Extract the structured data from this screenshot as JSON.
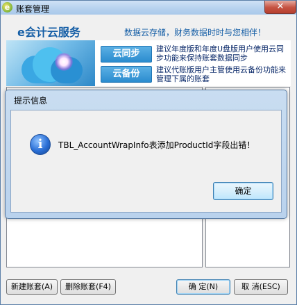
{
  "window": {
    "title": "账套管理",
    "app_icon": "e",
    "close_glyph": "✕"
  },
  "banner": {
    "title": "e会计云服务",
    "slogan": "数据云存储，财务数据时时与您相伴！",
    "services": [
      {
        "label": "云同步",
        "desc": "建议年度版和年度U盘版用户使用云同步功能来保持账套数据同步"
      },
      {
        "label": "云备份",
        "desc": "建议代账版用户主管使用云备份功能来管理下属的账套"
      }
    ]
  },
  "buttons": {
    "new_account": "新建账套(A)",
    "delete_account": "删除账套(F4)",
    "confirm": "确 定(N)",
    "cancel": "取 消(ESC)"
  },
  "dialog": {
    "title": "提示信息",
    "message": "TBL_AccountWrapInfo表添加ProductId字段出错！",
    "ok_label": "确定",
    "icon": "info-icon"
  }
}
